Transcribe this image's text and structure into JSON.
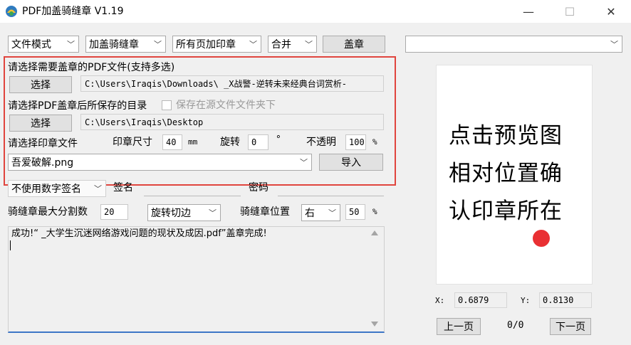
{
  "window": {
    "title": "PDF加盖骑缝章 V1.19",
    "minimize_glyph": "—",
    "maximize_glyph": "☐",
    "close_glyph": "✕"
  },
  "toolbar": {
    "mode_select": "文件模式",
    "stamp_type_select": "加盖骑缝章",
    "pages_select": "所有页加印章",
    "merge_select": "合并",
    "stamp_button": "盖章",
    "right_select": ""
  },
  "source": {
    "label": "请选择需要盖章的PDF文件(支持多选)",
    "button": "选择",
    "path": "C:\\Users\\Iraqis\\Downloads\\ _X战警-逆转未来经典台词赏析-"
  },
  "output": {
    "label": "请选择PDF盖章后所保存的目录",
    "save_in_source_label": "保存在源文件文件夹下",
    "button": "选择",
    "path": "C:\\Users\\Iraqis\\Desktop"
  },
  "seal": {
    "label": "请选择印章文件",
    "size_label": "印章尺寸",
    "size_value": "40",
    "size_unit": "mm",
    "rotate_label": "旋转",
    "rotate_value": "0",
    "rotate_unit": "°",
    "opacity_label": "不透明",
    "opacity_value": "100",
    "opacity_unit": "%",
    "file_select": "吾爱破解.png",
    "import_button": "导入"
  },
  "signature": {
    "select": "不使用数字签名",
    "sign_label": "签名",
    "password_label": "密码"
  },
  "split": {
    "max_label": "骑缝章最大分割数",
    "max_value": "20",
    "edge_select": "旋转切边",
    "pos_label": "骑缝章位置",
    "pos_select": "右",
    "pos_value": "50",
    "pos_unit": "%"
  },
  "log": {
    "message": "成功!“ _大学生沉迷网络游戏问题的现状及成因.pdf”盖章完成!"
  },
  "preview": {
    "line1": "点击预览图",
    "line2": "相对位置确",
    "line3": "认印章所在",
    "x_label": "X:",
    "x_value": "0.6879",
    "y_label": "Y:",
    "y_value": "0.8130",
    "prev_button": "上一页",
    "page_indicator": "0/0",
    "next_button": "下一页"
  },
  "colors": {
    "highlight_box": "#e0453e",
    "stamp_dot": "#e93033",
    "log_underline": "#3d76c6"
  }
}
